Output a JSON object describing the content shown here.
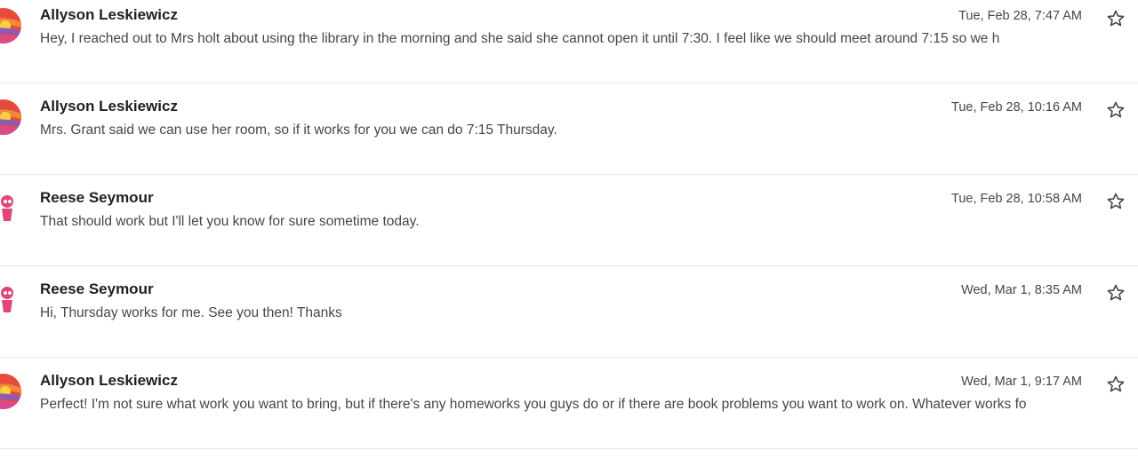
{
  "messages": [
    {
      "sender": "Allyson Leskiewicz",
      "snippet": "Hey, I reached out to Mrs holt about using the library in the morning and she said she cannot open it until 7:30. I feel like we should meet around 7:15 so we h",
      "date": "Tue, Feb 28, 7:47 AM",
      "avatar": "sunset-avatar"
    },
    {
      "sender": "Allyson Leskiewicz",
      "snippet": "Mrs. Grant said we can use her room, so if it works for you we can do 7:15 Thursday.",
      "date": "Tue, Feb 28, 10:16 AM",
      "avatar": "sunset-avatar"
    },
    {
      "sender": "Reese Seymour",
      "snippet": "That should work but I'll let you know for sure sometime today.",
      "date": "Tue, Feb 28, 10:58 AM",
      "avatar": "cartoon-avatar"
    },
    {
      "sender": "Reese Seymour",
      "snippet": "Hi, Thursday works for me. See you then! Thanks",
      "date": "Wed, Mar 1, 8:35 AM",
      "avatar": "cartoon-avatar"
    },
    {
      "sender": "Allyson Leskiewicz",
      "snippet": "Perfect! I'm not sure what work you want to bring, but if there's any homeworks you guys do or if there are book problems you want to work on. Whatever works fo",
      "date": "Wed, Mar 1, 9:17 AM",
      "avatar": "sunset-avatar"
    }
  ],
  "icons": {
    "star": "star-outline-icon"
  }
}
